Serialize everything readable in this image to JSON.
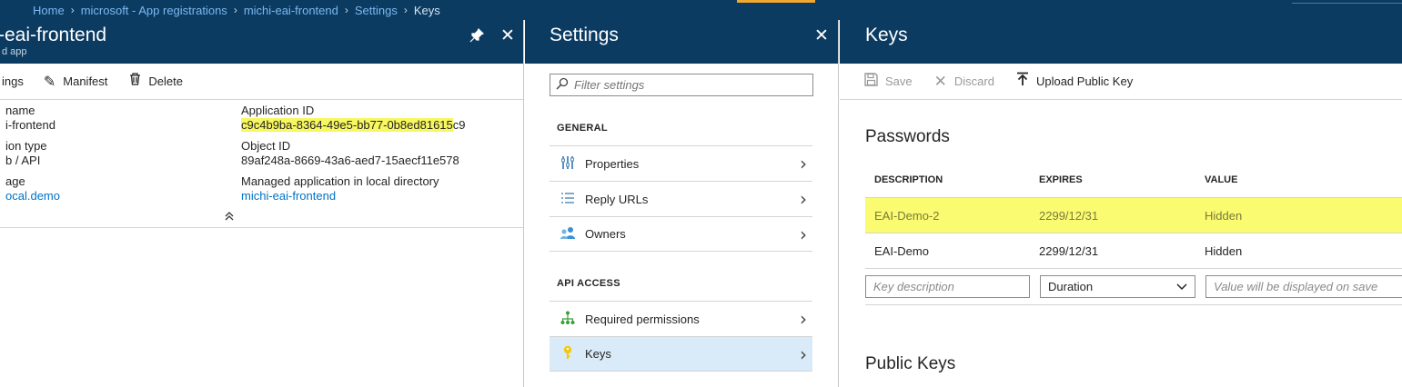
{
  "breadcrumb": {
    "items": [
      "Home",
      "microsoft - App registrations",
      "michi-eai-frontend",
      "Settings"
    ],
    "current": "Keys"
  },
  "app_blade": {
    "title": "-eai-frontend",
    "subtitle": "d app",
    "toolbar": {
      "settings": "ings",
      "manifest": "Manifest",
      "delete": "Delete"
    },
    "fields": {
      "name_label": "name",
      "name_value": "i-frontend",
      "type_label": "ion type",
      "type_value": "b / API",
      "homepage_label": "age",
      "homepage_value": "ocal.demo",
      "app_id_label": "Application ID",
      "app_id_value_hl": "c9c4b9ba-8364-49e5-bb77-0b8ed81615",
      "app_id_value_rest": "c9",
      "object_id_label": "Object ID",
      "object_id_value": "89af248a-8669-43a6-aed7-15aecf11e578",
      "managed_label": "Managed application in local directory",
      "managed_value": "michi-eai-frontend"
    }
  },
  "settings_blade": {
    "title": "Settings",
    "filter_placeholder": "Filter settings",
    "general_header": "GENERAL",
    "general_items": [
      "Properties",
      "Reply URLs",
      "Owners"
    ],
    "api_header": "API ACCESS",
    "api_items": [
      "Required permissions",
      "Keys"
    ]
  },
  "keys_blade": {
    "title": "Keys",
    "toolbar": {
      "save": "Save",
      "discard": "Discard",
      "upload": "Upload Public Key"
    },
    "passwords_title": "Passwords",
    "columns": [
      "DESCRIPTION",
      "EXPIRES",
      "VALUE"
    ],
    "rows": [
      {
        "description": "EAI-Demo-2",
        "expires": "2299/12/31",
        "value": "Hidden"
      },
      {
        "description": "EAI-Demo",
        "expires": "2299/12/31",
        "value": "Hidden"
      }
    ],
    "new_row": {
      "desc_placeholder": "Key description",
      "duration_value": "Duration",
      "value_placeholder": "Value will be displayed on save"
    },
    "public_keys_title": "Public Keys"
  },
  "colors": {
    "header": "#0c3b62",
    "link": "#0072c6",
    "highlight": "#f7f760",
    "selected": "#d9ebf8"
  }
}
